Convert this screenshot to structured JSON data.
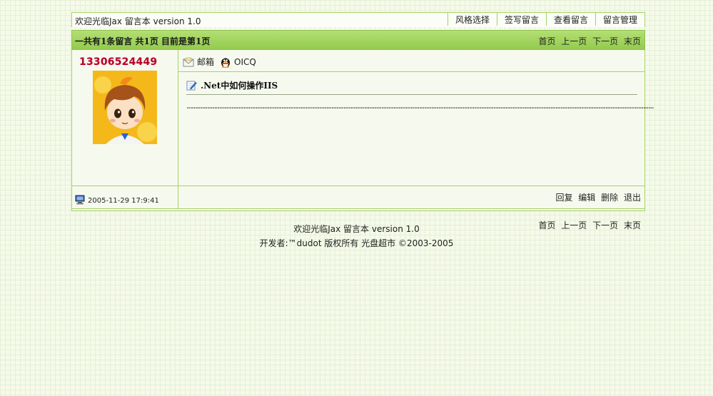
{
  "header": {
    "title": "欢迎光临Jax 留言本 version 1.0",
    "menu": [
      "风格选择",
      "签写留言",
      "查看留言",
      "留言管理"
    ]
  },
  "summary": "一共有1条留言 共1页 目前是第1页",
  "pager": {
    "first": "首页",
    "prev": "上一页",
    "next": "下一页",
    "last": "末页"
  },
  "message": {
    "username": "13306524449",
    "email_label": "邮箱",
    "oicq_label": "OICQ",
    "subject": ".Net中如何操作IIS",
    "body": "...............................................................................................................................................................................................................................................................................",
    "timestamp": "2005-11-29 17:9:41",
    "actions": {
      "reply": "回复",
      "edit": "编辑",
      "delete": "删除",
      "logout": "退出"
    }
  },
  "footer": {
    "line1": "欢迎光临Jax 留言本 version 1.0",
    "line2": "开发者:™dudot 版权所有 光盘超市 ©2003-2005"
  }
}
